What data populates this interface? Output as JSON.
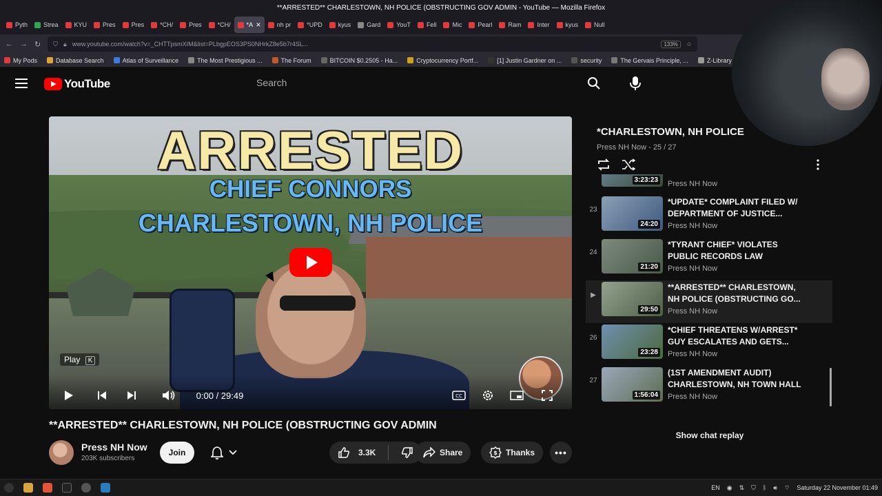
{
  "browser": {
    "window_title": "**ARRESTED** CHARLESTOWN, NH POLICE (OBSTRUCTING GOV ADMIN - YouTube — Mozilla Firefox",
    "tabs": [
      {
        "label": "Pyth",
        "color": "#e03a3a"
      },
      {
        "label": "Strea",
        "color": "#2fa84f"
      },
      {
        "label": "KYU",
        "color": "#e03a3a"
      },
      {
        "label": "Pres",
        "color": "#e03a3a"
      },
      {
        "label": "Pres",
        "color": "#e03a3a"
      },
      {
        "label": "*CH/",
        "color": "#e03a3a"
      },
      {
        "label": "Pres",
        "color": "#e03a3a"
      },
      {
        "label": "*CH/",
        "color": "#e03a3a"
      },
      {
        "label": "*A",
        "color": "#e03a3a",
        "active": true
      },
      {
        "label": "nh pr",
        "color": "#e03a3a"
      },
      {
        "label": "*UPD",
        "color": "#e03a3a"
      },
      {
        "label": "kyus",
        "color": "#e03a3a"
      },
      {
        "label": "Gard",
        "color": "#888888"
      },
      {
        "label": "YouT",
        "color": "#e03a3a"
      },
      {
        "label": "Fell",
        "color": "#e03a3a"
      },
      {
        "label": "Mic",
        "color": "#e03a3a"
      },
      {
        "label": "Pearl",
        "color": "#e03a3a"
      },
      {
        "label": "Ram",
        "color": "#e03a3a"
      },
      {
        "label": "Inter",
        "color": "#e03a3a"
      },
      {
        "label": "kyus",
        "color": "#e03a3a"
      },
      {
        "label": "Null",
        "color": "#e03a3a"
      }
    ],
    "url": "www.youtube.com/watch?v=_CHTTpsmXIM&list=PLbgpEOS3PS0NHrkZ8e5b7r4SL...",
    "zoom": "133%",
    "bookmarks": [
      "My Pods",
      "Database Search",
      "Atlas of Surveillance",
      "The Most Prestigious ...",
      "The Forum",
      "BITCOIN $0.2505 - Ha...",
      "Cryptocurrency Portf...",
      "[1] Justin Gardner on ...",
      "security",
      "The Gervais Principle, ...",
      "Z-Library – the world's..."
    ]
  },
  "youtube": {
    "logo_text": "YouTube",
    "search_placeholder": "Search"
  },
  "player": {
    "thumb_title": "ARRESTED",
    "thumb_sub1": "CHIEF CONNORS",
    "thumb_sub2": "CHARLESTOWN, NH POLICE",
    "play_tooltip": "Play",
    "play_key": "K",
    "time": "0:00 / 29:49",
    "progress": 0
  },
  "video": {
    "title": "**ARRESTED** CHARLESTOWN, NH POLICE (OBSTRUCTING GOV ADMIN",
    "channel": "Press NH Now",
    "subscribers": "203K subscribers",
    "join": "Join",
    "likes": "3.3K",
    "share": "Share",
    "thanks": "Thanks"
  },
  "playlist": {
    "title": "*CHARLESTOWN, NH POLICE",
    "meta": "Press NH Now - 25 / 27",
    "partial_item": {
      "duration": "3:23:23",
      "channel": "Press NH Now"
    },
    "items": [
      {
        "num": "23",
        "title": "*UPDATE* COMPLAINT FILED W/ DEPARTMENT OF JUSTICE...",
        "channel": "Press NH Now",
        "duration": "24:20"
      },
      {
        "num": "24",
        "title": "*TYRANT CHIEF* VIOLATES PUBLIC RECORDS LAW",
        "channel": "Press NH Now",
        "duration": "21:20"
      },
      {
        "num": "▶",
        "title": "**ARRESTED** CHARLESTOWN, NH POLICE (OBSTRUCTING GO...",
        "channel": "Press NH Now",
        "duration": "29:50",
        "current": true
      },
      {
        "num": "26",
        "title": "*CHIEF THREATENS W/ARREST* GUY ESCALATES AND GETS...",
        "channel": "Press NH Now",
        "duration": "23:28"
      },
      {
        "num": "27",
        "title": "(1ST AMENDMENT AUDIT) CHARLESTOWN, NH TOWN HALL",
        "channel": "Press NH Now",
        "duration": "1:56:04"
      }
    ],
    "chat_replay": "Show chat replay"
  },
  "taskbar": {
    "lang": "EN",
    "datetime": "Saturday 22 November 01:49"
  },
  "colors": {
    "yt_red": "#ff0000",
    "bg": "#0f0f0f",
    "pill": "#272727"
  }
}
